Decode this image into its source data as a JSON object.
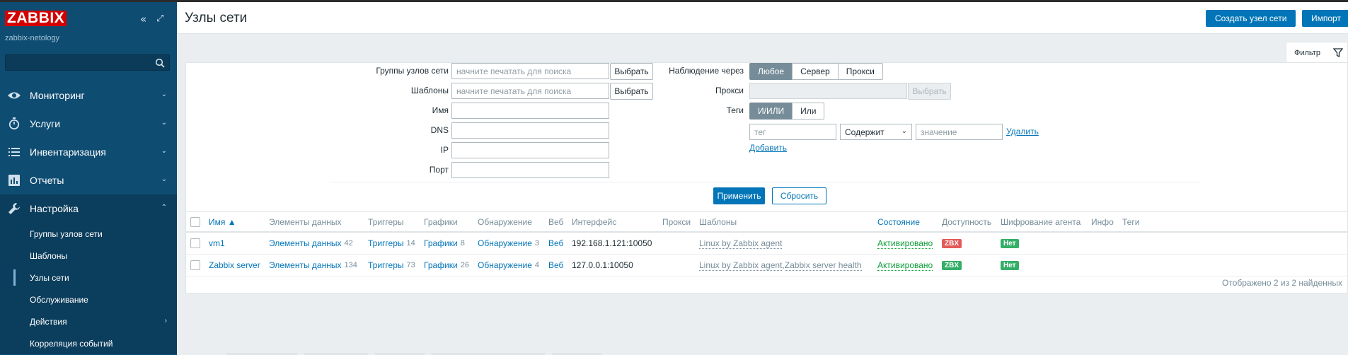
{
  "sidebar": {
    "logo": "ZABBIX",
    "subtitle": "zabbix-netology",
    "collapse_glyph": "«",
    "expand_glyph": "⤢",
    "search_placeholder": "",
    "menu": [
      {
        "label": "Мониторинг",
        "icon": "eye-icon",
        "arrow": "⌄"
      },
      {
        "label": "Услуги",
        "icon": "stopwatch-icon",
        "arrow": "⌄"
      },
      {
        "label": "Инвентаризация",
        "icon": "list-icon",
        "arrow": "⌄"
      },
      {
        "label": "Отчеты",
        "icon": "chart-icon",
        "arrow": "⌄"
      },
      {
        "label": "Настройка",
        "icon": "wrench-icon",
        "arrow": "⌃"
      }
    ],
    "submenu": [
      {
        "label": "Группы узлов сети"
      },
      {
        "label": "Шаблоны"
      },
      {
        "label": "Узлы сети"
      },
      {
        "label": "Обслуживание"
      },
      {
        "label": "Действия",
        "arrow": "›"
      },
      {
        "label": "Корреляция событий"
      }
    ]
  },
  "header": {
    "title": "Узлы сети",
    "create_button": "Создать узел сети",
    "import_button": "Импорт"
  },
  "filter": {
    "tab_label": "Фильтр",
    "host_groups": {
      "label": "Группы узлов сети",
      "placeholder": "начните печатать для поиска",
      "button": "Выбрать"
    },
    "templates": {
      "label": "Шаблоны",
      "placeholder": "начните печатать для поиска",
      "button": "Выбрать"
    },
    "name": {
      "label": "Имя",
      "value": ""
    },
    "dns": {
      "label": "DNS",
      "value": ""
    },
    "ip": {
      "label": "IP",
      "value": ""
    },
    "port": {
      "label": "Порт",
      "value": ""
    },
    "monitored_by": {
      "label": "Наблюдение через",
      "options": [
        "Любое",
        "Сервер",
        "Прокси"
      ],
      "selected": "Любое"
    },
    "proxy": {
      "label": "Прокси",
      "value": "",
      "button": "Выбрать"
    },
    "tags": {
      "label": "Теги",
      "options": [
        "И/ИЛИ",
        "Или"
      ],
      "selected": "И/ИЛИ",
      "tag_placeholder": "тег",
      "operator": "Содержит",
      "value_placeholder": "значение",
      "remove_link": "Удалить",
      "add_link": "Добавить"
    },
    "apply_button": "Применить",
    "reset_button": "Сбросить"
  },
  "table": {
    "columns": [
      "Имя ▲",
      "Элементы данных",
      "Триггеры",
      "Графики",
      "Обнаружение",
      "Веб",
      "Интерфейс",
      "Прокси",
      "Шаблоны",
      "Состояние",
      "Доступность",
      "Шифрование агента",
      "Инфо",
      "Теги"
    ],
    "rows": [
      {
        "name": "vm1",
        "items_label": "Элементы данных",
        "items_count": "42",
        "triggers_label": "Триггеры",
        "triggers_count": "14",
        "graphs_label": "Графики",
        "graphs_count": "8",
        "discovery_label": "Обнаружение",
        "discovery_count": "3",
        "web": "Веб",
        "interface": "192.168.1.121:10050",
        "proxy": "",
        "template_1": "Linux by Zabbix agent",
        "template_sep": "",
        "template_2": "",
        "status": "Активировано",
        "availability": "ZBX",
        "availability_color": "#e45959",
        "encryption": "Нет"
      },
      {
        "name": "Zabbix server",
        "items_label": "Элементы данных",
        "items_count": "134",
        "triggers_label": "Триггеры",
        "triggers_count": "73",
        "graphs_label": "Графики",
        "graphs_count": "26",
        "discovery_label": "Обнаружение",
        "discovery_count": "4",
        "web": "Веб",
        "interface": "127.0.0.1:10050",
        "proxy": "",
        "template_1": "Linux by Zabbix agent",
        "template_sep": ", ",
        "template_2": "Zabbix server health",
        "status": "Активировано",
        "availability": "ZBX",
        "availability_color": "#34af67",
        "encryption": "Нет"
      }
    ],
    "footer": "Отображено 2 из 2 найденных"
  },
  "colors": {
    "sidebar_bg": "#0e4c72",
    "accent": "#0275b8",
    "status_green": "#0e9f3a",
    "badge_red": "#e45959",
    "badge_green": "#34af67"
  }
}
